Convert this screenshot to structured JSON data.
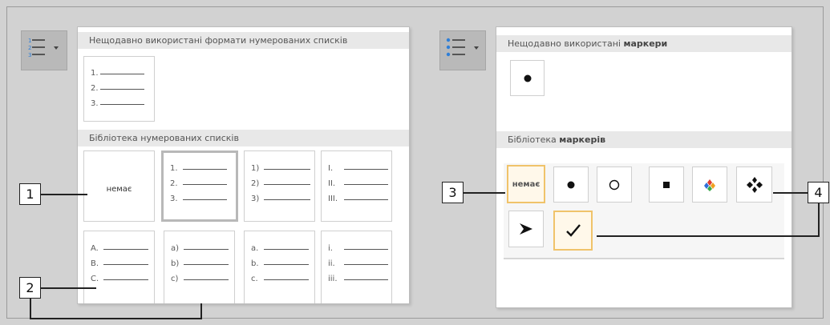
{
  "left_menu": {
    "recent_header": "Нещодавно використані формати нумерованих списків",
    "library_header": "Бібліотека нумерованих списків",
    "recent_formats": [
      {
        "rows": [
          "1.",
          "2.",
          "3."
        ]
      }
    ],
    "library_formats": [
      {
        "none_label": "немає"
      },
      {
        "rows": [
          "1.",
          "2.",
          "3."
        ],
        "selected": true
      },
      {
        "rows": [
          "1)",
          "2)",
          "3)"
        ]
      },
      {
        "rows": [
          "I.",
          "II.",
          "III."
        ]
      },
      {
        "rows": [
          "A.",
          "B.",
          "C."
        ]
      },
      {
        "rows": [
          "a)",
          "b)",
          "c)"
        ]
      },
      {
        "rows": [
          "a.",
          "b.",
          "c."
        ]
      },
      {
        "rows": [
          "i.",
          "ii.",
          "iii."
        ]
      }
    ]
  },
  "right_menu": {
    "recent_header_prefix": "Нещодавно використані",
    "recent_header_bold": "маркери",
    "library_header_prefix": "Бібліотека",
    "library_header_bold": "маркерів",
    "none_label": "немає",
    "bullets": [
      "none",
      "filled-circle",
      "hollow-circle",
      "filled-square",
      "color-diamonds",
      "four-diamonds",
      "arrowhead",
      "checkmark"
    ]
  },
  "callouts": [
    "1",
    "2",
    "3",
    "4"
  ],
  "colors": {
    "highlight_border": "#f0c36a",
    "ribbon_button": "#b9b9b9",
    "accent_blue": "#2f7fd8"
  }
}
